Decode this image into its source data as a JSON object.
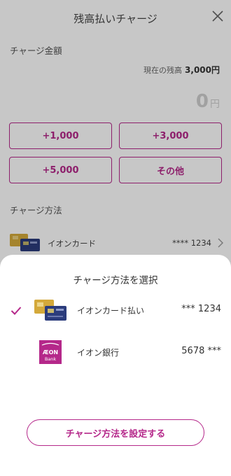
{
  "header": {
    "title": "残高払いチャージ"
  },
  "charge_amount": {
    "label": "チャージ金額",
    "current_balance_label": "現在の残高",
    "current_balance_value": "3,000円",
    "amount_value": "0",
    "amount_unit": "円"
  },
  "amount_buttons": [
    "+1,000",
    "+3,000",
    "+5,000",
    "その他"
  ],
  "charge_method": {
    "label": "チャージ方法",
    "selected_name": "イオンカード",
    "selected_number": "**** 1234"
  },
  "sheet": {
    "title": "チャージ方法を選択",
    "options": [
      {
        "name": "イオンカード払い",
        "number": "*** 1234",
        "selected": true
      },
      {
        "name": "イオン銀行",
        "number": "5678 ***",
        "selected": false
      }
    ],
    "bank_logo_text": "ÆON",
    "bank_logo_sub": "Bank",
    "confirm_label": "チャージ方法を設定する"
  },
  "colors": {
    "accent": "#b5288a",
    "overlay": "rgba(0,0,0,0.22)"
  },
  "icons": {
    "close": "close-icon",
    "check": "check-icon",
    "chevron": "chevron-right-icon"
  }
}
